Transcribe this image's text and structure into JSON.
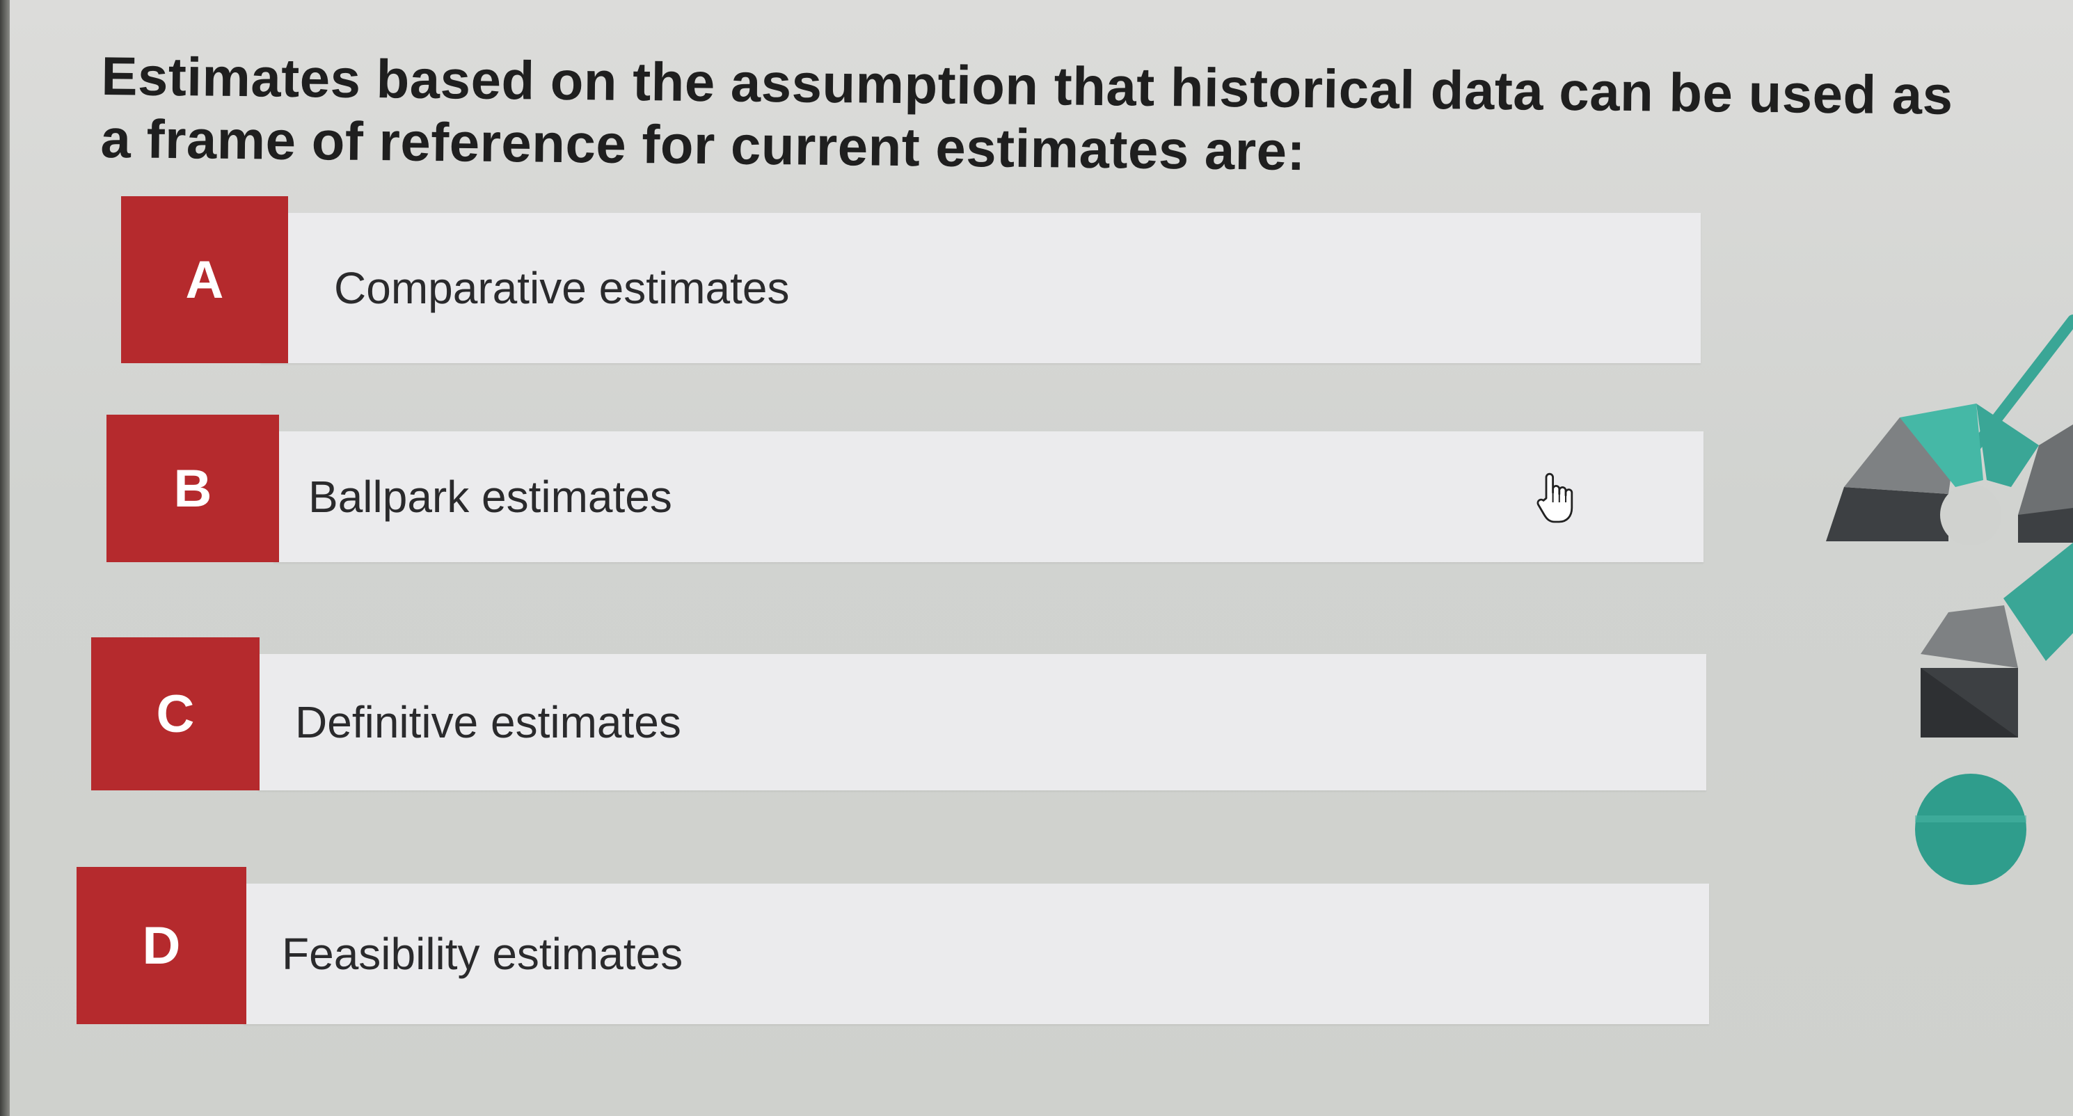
{
  "question": {
    "text": "Estimates based on the assumption that historical data can be used as a frame of reference for current estimates are:"
  },
  "options": [
    {
      "letter": "A",
      "label": "Comparative estimates"
    },
    {
      "letter": "B",
      "label": "Ballpark estimates"
    },
    {
      "letter": "C",
      "label": "Definitive estimates"
    },
    {
      "letter": "D",
      "label": "Feasibility estimates"
    }
  ],
  "colors": {
    "letter_box": "#b52a2d",
    "option_bar": "#ebebed",
    "decoration_teal": "#3aa696",
    "decoration_dark": "#3d4043",
    "decoration_gray": "#7e8183"
  },
  "icons": {
    "cursor": "hand-pointer-icon",
    "decoration": "question-mark-graphic-icon"
  }
}
